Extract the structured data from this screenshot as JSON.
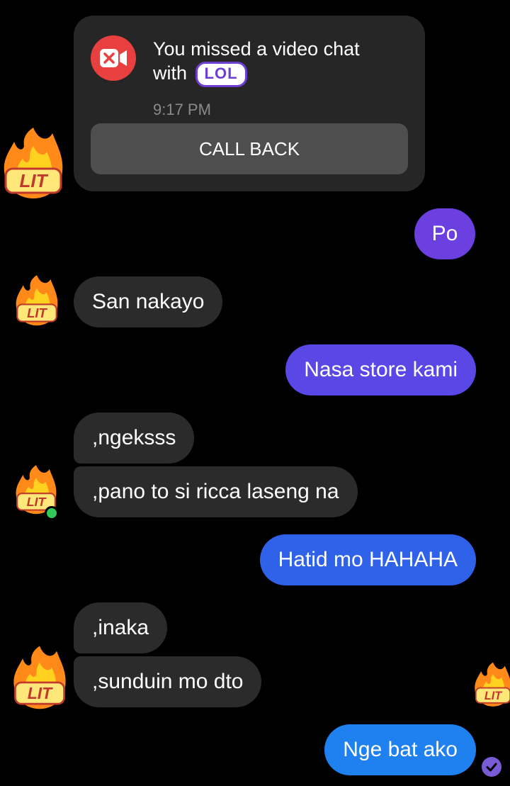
{
  "missed_call": {
    "text": "You missed a video chat with",
    "sticker": "LOL",
    "time": "9:17 PM",
    "button": "CALL BACK"
  },
  "avatar_sticker": "LIT",
  "messages": [
    {
      "side": "out",
      "text": "Po"
    },
    {
      "side": "in",
      "text": "San nakayo"
    },
    {
      "side": "out",
      "text": "Nasa store kami"
    },
    {
      "side": "in",
      "text": ",ngeksss"
    },
    {
      "side": "in",
      "text": ",pano to si ricca laseng na"
    },
    {
      "side": "out",
      "text": "Hatid mo HAHAHA"
    },
    {
      "side": "in",
      "text": ",inaka"
    },
    {
      "side": "in",
      "text": ",sunduin mo dto"
    },
    {
      "side": "out",
      "text": "Nge bat ako"
    }
  ],
  "colors": {
    "background": "#000000",
    "incoming_bubble": "#2b2b2b",
    "outgoing_gradient": [
      "#6b3fe0",
      "#5a48e6",
      "#3f60e8",
      "#2f6ef0",
      "#1f80f0"
    ],
    "missed_call_icon": "#e8403e",
    "online": "#34c759"
  },
  "icons": [
    "video-off-icon",
    "lit-fire-sticker",
    "seen-check-icon"
  ]
}
